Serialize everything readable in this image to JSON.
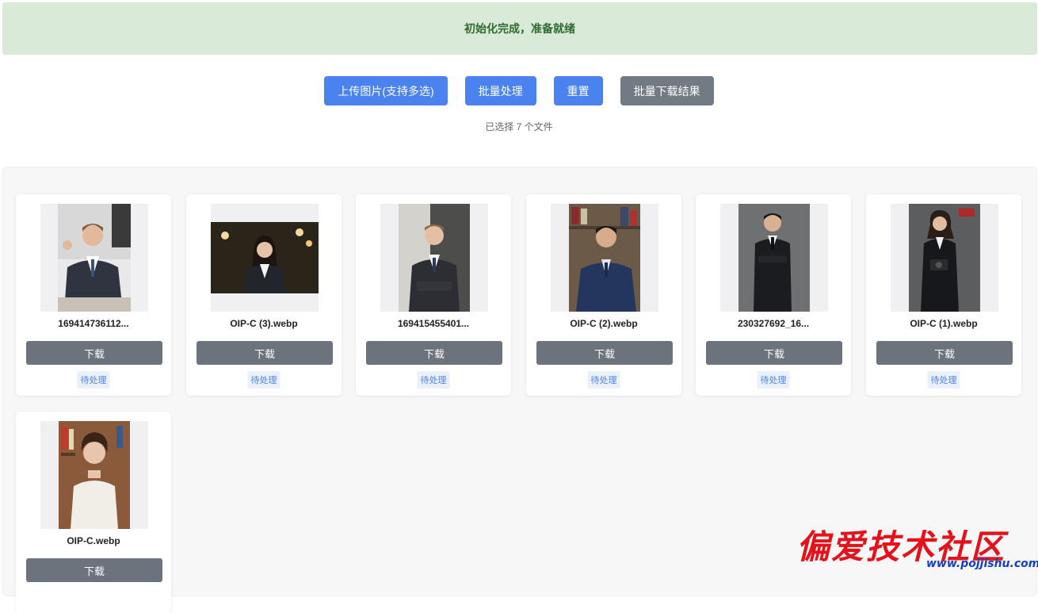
{
  "status": {
    "message": "初始化完成，准备就绪"
  },
  "toolbar": {
    "upload_label": "上传图片(支持多选)",
    "batch_process_label": "批量处理",
    "reset_label": "重置",
    "batch_download_label": "批量下载结果"
  },
  "selection": {
    "count_text": "已选择 7 个文件"
  },
  "cards": [
    {
      "name": "169414736112...",
      "download_label": "下载",
      "status": "待处理"
    },
    {
      "name": "OIP-C (3).webp",
      "download_label": "下载",
      "status": "待处理"
    },
    {
      "name": "169415455401...",
      "download_label": "下载",
      "status": "待处理"
    },
    {
      "name": "OIP-C (2).webp",
      "download_label": "下载",
      "status": "待处理"
    },
    {
      "name": "230327692_16...",
      "download_label": "下载",
      "status": "待处理"
    },
    {
      "name": "OIP-C (1).webp",
      "download_label": "下载",
      "status": "待处理"
    },
    {
      "name": "OIP-C.webp",
      "download_label": "下载",
      "status": ""
    }
  ],
  "watermark": {
    "title": "偏爱技术社区",
    "url": "www.pojjishu.com"
  },
  "colors": {
    "primary": "#4a82f0",
    "secondary": "#727a84",
    "status_bg": "#d9ead8",
    "status_text": "#2f6b2f"
  }
}
